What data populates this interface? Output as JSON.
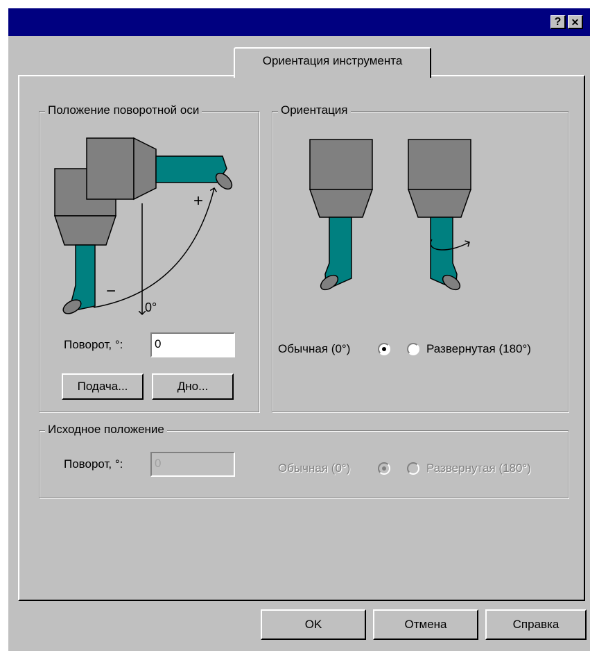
{
  "titlebar": {
    "help_glyph": "?",
    "close_glyph": "✕"
  },
  "tab": {
    "label": "Ориентация инструмента"
  },
  "pivot_group": {
    "legend": "Положение поворотной оси",
    "diagram": {
      "plus": "+",
      "minus": "−",
      "zero": "0°"
    },
    "rotation_label": "Поворот, °:",
    "rotation_value": "0",
    "feed_button": "Подача...",
    "bottom_button": "Дно..."
  },
  "orientation_group": {
    "legend": "Ориентация",
    "normal_label": "Обычная (0°)",
    "reversed_label": "Развернутая (180°)",
    "selected": "normal"
  },
  "initial_group": {
    "legend": "Исходное положение",
    "rotation_label": "Поворот, °:",
    "rotation_value": "0",
    "normal_label": "Обычная (0°)",
    "reversed_label": "Развернутая (180°)",
    "selected": "normal"
  },
  "footer": {
    "ok": "OK",
    "cancel": "Отмена",
    "help": "Справка"
  },
  "colors": {
    "titlebar": "#000080",
    "tool_teal": "#008080",
    "tool_gray": "#808080",
    "face": "#c0c0c0"
  }
}
